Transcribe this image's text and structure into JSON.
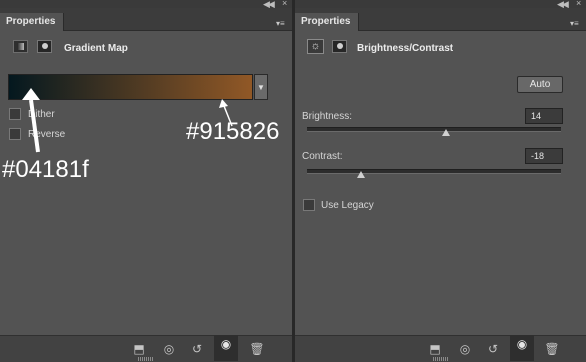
{
  "left_panel": {
    "tab_label": "Properties",
    "header_title": "Gradient Map",
    "gradient": {
      "start_color": "#04181f",
      "end_color": "#915826"
    },
    "options": [
      {
        "label": "Dither",
        "checked": false
      },
      {
        "label": "Reverse",
        "checked": false
      }
    ],
    "annotations": {
      "start_color_label": "#04181f",
      "end_color_label": "#915826"
    },
    "bottom_icons": [
      "clip-to-layer-icon",
      "view-previous-state-icon",
      "reset-icon",
      "toggle-visibility-icon",
      "trash-icon"
    ]
  },
  "right_panel": {
    "tab_label": "Properties",
    "header_title": "Brightness/Contrast",
    "auto_label": "Auto",
    "brightness": {
      "label": "Brightness:",
      "value": "14",
      "range": [
        -150,
        150
      ]
    },
    "contrast": {
      "label": "Contrast:",
      "value": "-18",
      "range": [
        -50,
        100
      ]
    },
    "use_legacy": {
      "label": "Use Legacy",
      "checked": false
    },
    "bottom_icons": [
      "clip-to-layer-icon",
      "view-previous-state-icon",
      "reset-icon",
      "toggle-visibility-icon",
      "trash-icon"
    ]
  },
  "colors": {
    "panel_bg": "#535353",
    "tab_bar_bg": "#3c3c3c",
    "annotation_text": "#ffffff"
  }
}
